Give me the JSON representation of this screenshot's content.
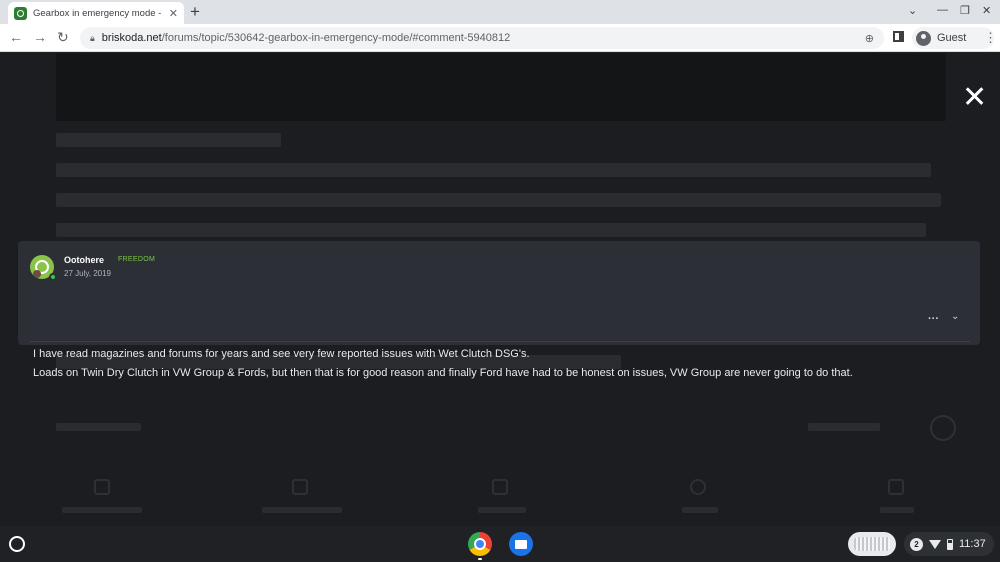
{
  "browser": {
    "tab_title": "Gearbox in emergency mode - Sk",
    "tab_close": "✕",
    "new_tab": "+",
    "url_host": "briskoda.net",
    "url_path": "/forums/topic/530642-gearbox-in-emergency-mode/#comment-5940812",
    "profile_label": "Guest"
  },
  "overlay": {
    "close_symbol": "✕"
  },
  "post": {
    "author": "Ootohere",
    "badge": "FREEDOM",
    "date": "27 July, 2019",
    "body_lines": [
      "I have read magazines and forums for years and see very few reported issues with Wet Clutch DSG's.",
      "Loads on Twin Dry Clutch in VW Group & Fords, but then that is for good reason and finally Ford have had to be honest on issues, VW Group are never going to do that."
    ],
    "more_symbol": "···",
    "expand_symbol": "⌄"
  },
  "shelf": {
    "notification_count": "2",
    "clock": "11:37"
  },
  "icons": {
    "back": "back-arrow-icon",
    "forward": "forward-arrow-icon",
    "reload": "reload-icon",
    "lock": "lock-icon",
    "zoom": "zoom-icon",
    "overlay_close": "close-icon"
  }
}
